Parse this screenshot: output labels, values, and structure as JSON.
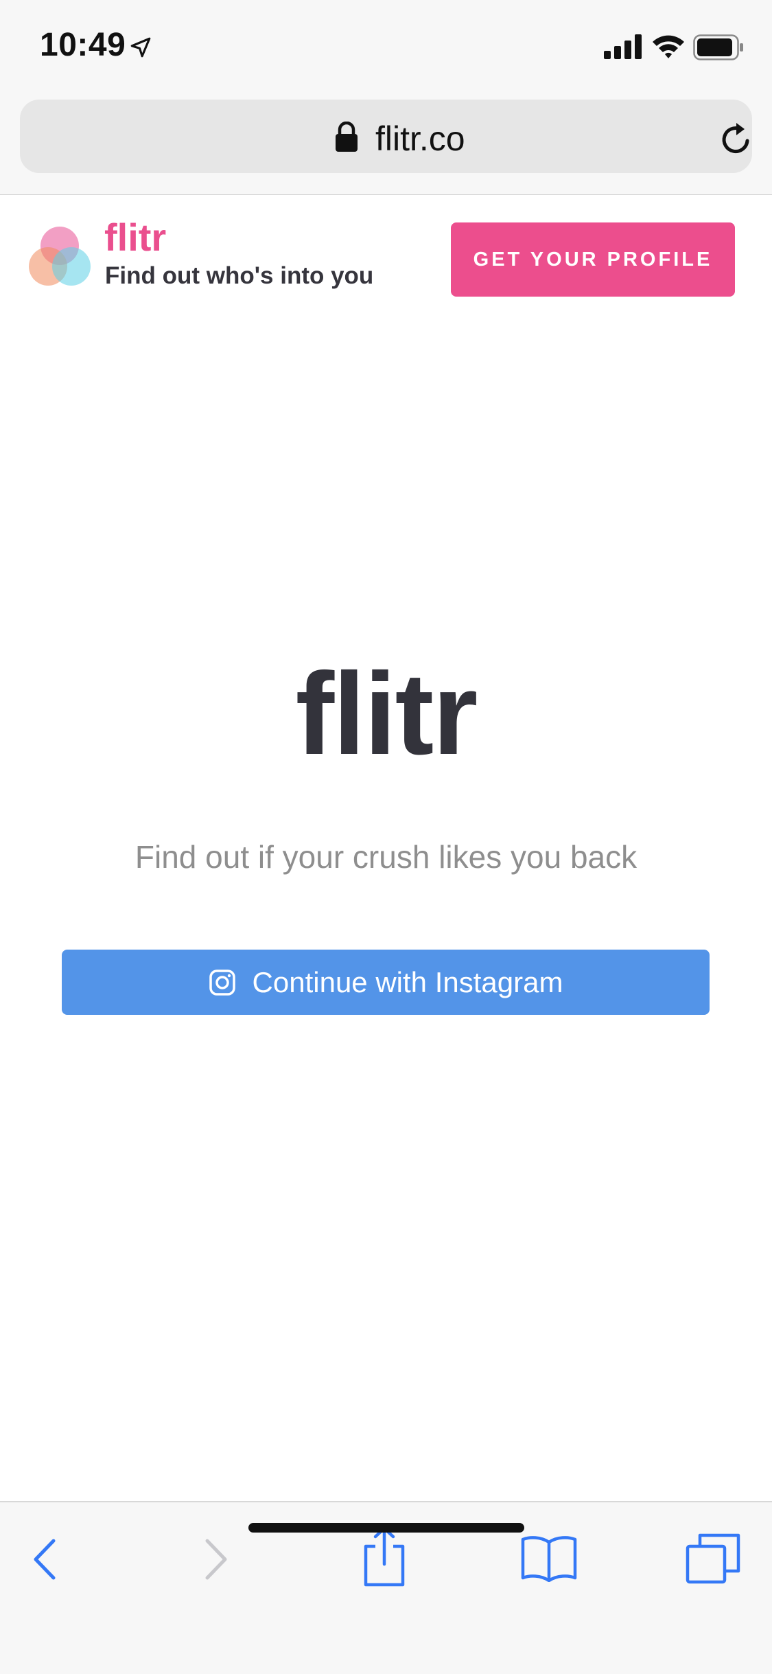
{
  "status_bar": {
    "time": "10:49"
  },
  "browser": {
    "url": "flitr.co"
  },
  "site_header": {
    "brand_name": "flitr",
    "tagline": "Find out who's into you",
    "cta_label": "GET YOUR PROFILE"
  },
  "hero": {
    "title": "flitr",
    "subtitle": "Find out if your crush likes you back",
    "instagram_button_label": "Continue with Instagram"
  },
  "icons": {
    "status": [
      "location-arrow-icon",
      "signal-icon",
      "wifi-icon",
      "battery-icon"
    ],
    "browser": [
      "lock-icon",
      "reload-icon"
    ],
    "toolbar": [
      "back-icon",
      "forward-icon",
      "share-icon",
      "bookmarks-icon",
      "tabs-icon"
    ],
    "brand": [
      "flitr-logo"
    ],
    "hero": [
      "instagram-icon"
    ]
  },
  "colors": {
    "brand_pink": "#ea4f8e",
    "instagram_blue": "#5394e8",
    "ios_blue": "#3478f6",
    "title_dark": "#33333b",
    "subtitle_gray": "#8e8e8e"
  }
}
